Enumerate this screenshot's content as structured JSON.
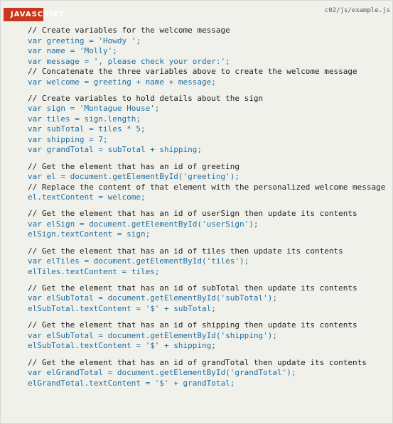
{
  "header": {
    "language_tag": "JAVASCRIPT",
    "file_path": "c02/js/example.js"
  },
  "code_blocks": [
    [
      {
        "type": "comment",
        "text": "// Create variables for the welcome message"
      },
      {
        "type": "code",
        "text": "var greeting = 'Howdy ';"
      },
      {
        "type": "code",
        "text": "var name = 'Molly';"
      },
      {
        "type": "code",
        "text": "var message = ', please check your order:';"
      },
      {
        "type": "comment",
        "text": "// Concatenate the three variables above to create the welcome message"
      },
      {
        "type": "code",
        "text": "var welcome = greeting + name + message;"
      }
    ],
    [
      {
        "type": "comment",
        "text": "// Create variables to hold details about the sign"
      },
      {
        "type": "code",
        "text": "var sign = 'Montague House';"
      },
      {
        "type": "code",
        "text": "var tiles = sign.length;"
      },
      {
        "type": "code",
        "text": "var subTotal = tiles * 5;"
      },
      {
        "type": "code",
        "text": "var shipping = 7;"
      },
      {
        "type": "code",
        "text": "var grandTotal = subTotal + shipping;"
      }
    ],
    [
      {
        "type": "comment",
        "text": "// Get the element that has an id of greeting"
      },
      {
        "type": "code",
        "text": "var el = document.getElementById('greeting');"
      },
      {
        "type": "comment",
        "text": "// Replace the content of that element with the personalized welcome message"
      },
      {
        "type": "code",
        "text": "el.textContent = welcome;"
      }
    ],
    [
      {
        "type": "comment",
        "text": "// Get the element that has an id of userSign then update its contents"
      },
      {
        "type": "code",
        "text": "var elSign = document.getElementById('userSign');"
      },
      {
        "type": "code",
        "text": "elSign.textContent = sign;"
      }
    ],
    [
      {
        "type": "comment",
        "text": "// Get the element that has an id of tiles then update its contents"
      },
      {
        "type": "code",
        "text": "var elTiles = document.getElementById('tiles');"
      },
      {
        "type": "code",
        "text": "elTiles.textContent = tiles;"
      }
    ],
    [
      {
        "type": "comment",
        "text": "// Get the element that has an id of subTotal then update its contents"
      },
      {
        "type": "code",
        "text": "var elSubTotal = document.getElementById('subTotal');"
      },
      {
        "type": "code",
        "text": "elSubTotal.textContent = '$' + subTotal;"
      }
    ],
    [
      {
        "type": "comment",
        "text": "// Get the element that has an id of shipping then update its contents"
      },
      {
        "type": "code",
        "text": "var elSubTotal = document.getElementById('shipping');"
      },
      {
        "type": "code",
        "text": "elSubTotal.textContent = '$' + shipping;"
      }
    ],
    [
      {
        "type": "comment",
        "text": "// Get the element that has an id of grandTotal then update its contents"
      },
      {
        "type": "code",
        "text": "var elGrandTotal = document.getElementById('grandTotal');"
      },
      {
        "type": "code",
        "text": "elGrandTotal.textContent = '$' + grandTotal;"
      }
    ]
  ],
  "colors": {
    "tag_background": "#c8381f",
    "code_text": "#1f6fa3",
    "comment_text": "#222222",
    "page_background": "#f0f1eb"
  }
}
